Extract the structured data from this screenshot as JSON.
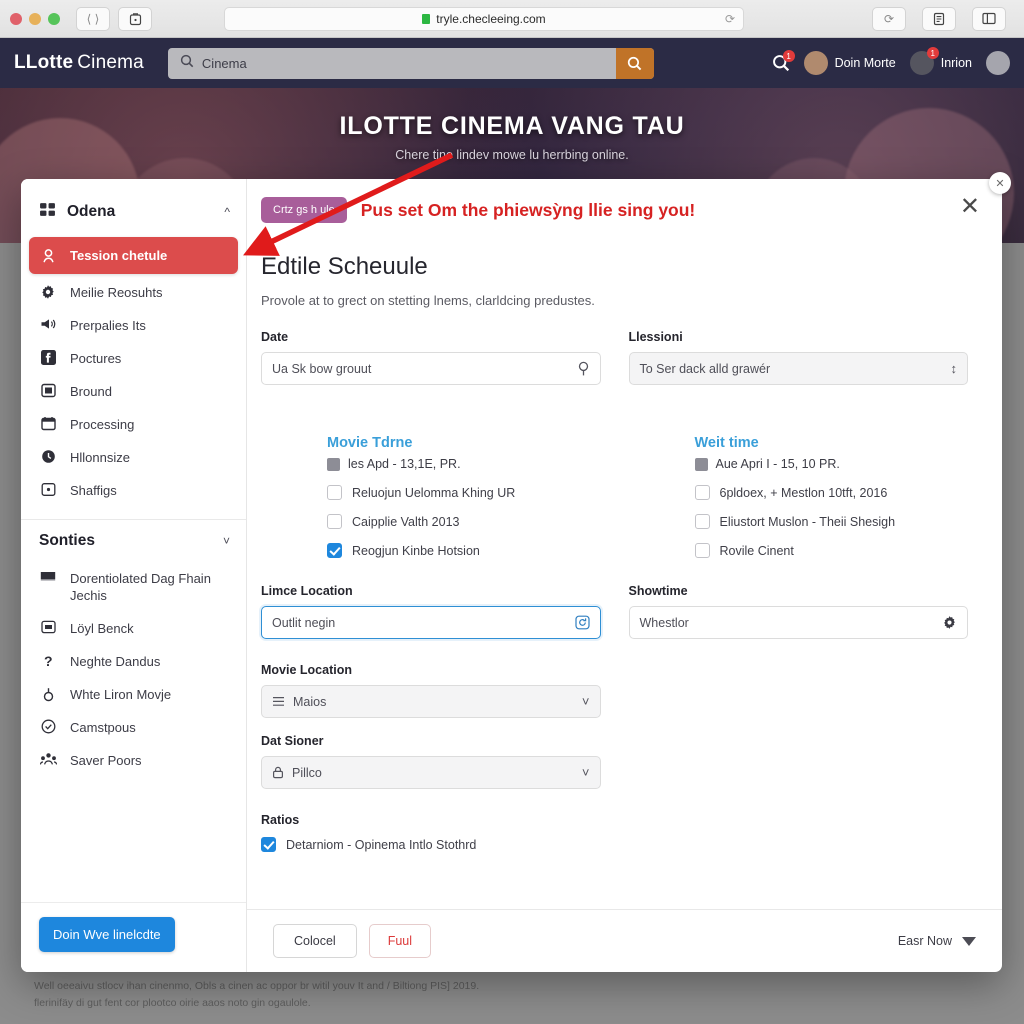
{
  "browser": {
    "url": "tryle.checleeing.com",
    "nav_back_forward_icon": "back-forward-icon",
    "tab_icon": "tab-overview-icon",
    "reload_icon": "reload-icon",
    "share_icon": "share-icon",
    "readinglist_icon": "reading-list-icon",
    "sidebar_icon": "sidebar-icon"
  },
  "site_header": {
    "brand_bold": "LLotte",
    "brand_light": "Cinema",
    "search_value": "Cinema",
    "search_placeholder": "Cinema",
    "search_icon": "search-icon",
    "search_submit_icon": "search-icon",
    "notif_search_badge": "1",
    "user_name": "Doin Morte",
    "menu_name": "Inrion",
    "menu_badge": "1",
    "accent_orange": "#c07328",
    "bar_color": "#2b2b45"
  },
  "hero": {
    "title": "ILOTTE CINEMA VANG TAU",
    "subtitle": "Chere tine lindev mowe lu herrbing online."
  },
  "modal": {
    "close_icon": "close-icon",
    "close_outer_icon": "close-icon",
    "pill_label": "Crtz gs h ule",
    "alert_text": "Pus set Om the phiewsỳng llie sing you!",
    "heading": "Edtile Scheuule",
    "description": "Provole at to grect on stetting lnems, clarldcing predustes.",
    "left": {
      "date_label": "Date",
      "date_value": "Ua Sk bow grouut",
      "date_icon": "location-pin-icon",
      "sub_title": "Movie Tdrne",
      "sub_line": "les Apd - 13,1E, PR.",
      "sub_line_icon": "calendar-icon",
      "options": [
        {
          "label": "Reluojun Uelomma Khing UR",
          "checked": false
        },
        {
          "label": "Caipplie Valth 2013",
          "checked": false
        },
        {
          "label": "Reogjun Kinbe Hotsion",
          "checked": true
        }
      ],
      "lince_label": "Limce Location",
      "lince_value": "Outlit negin",
      "lince_icon": "refresh-circle-icon",
      "movie_loc_label": "Movie Location",
      "movie_loc_value": "Maios",
      "movie_loc_icon": "list-icon",
      "movie_loc_caret": "chevron-down-icon",
      "dat_label": "Dat Sioner",
      "dat_value": "Pillco",
      "dat_icon": "lock-icon",
      "dat_caret": "chevron-down-icon",
      "ratios_label": "Ratios",
      "ratios_option": "Detarniom - Opinema Intlo Stothrd",
      "ratios_checked": true
    },
    "right": {
      "lessioni_label": "Llessioni",
      "lessioni_value": "To Ser dack alld grawér",
      "lessioni_icon": "stepper-icon",
      "sub_title": "Weit time",
      "sub_line": "Aue Apri I - 15, 10 PR.",
      "sub_line_icon": "calendar-icon",
      "options": [
        {
          "label": "6pldoex, + Mestlon 10tft, 2016",
          "checked": false
        },
        {
          "label": "Eliustort Muslon - Theii Shesigh",
          "checked": false
        },
        {
          "label": "Rovile Cinent",
          "checked": false
        }
      ],
      "showtime_label": "Showtime",
      "showtime_value": "Whestlor",
      "showtime_icon": "gear-icon"
    },
    "footer": {
      "cancel_label": "Colocel",
      "submit_label": "Fuul",
      "right_label": "Easr Now",
      "right_caret_icon": "caret-down-icon"
    }
  },
  "sidebar": {
    "group_title": "Odena",
    "group_icon": "building-icon",
    "group_caret_icon": "chevron-up-icon",
    "items": [
      {
        "label": "Tession chetule",
        "icon": "person-pin-icon",
        "active": true
      },
      {
        "label": "Meilie Reosuhts",
        "icon": "gear-icon",
        "active": false
      },
      {
        "label": "Prerpalies Its",
        "icon": "megaphone-icon",
        "active": false
      },
      {
        "label": "Poctures",
        "icon": "facebook-icon",
        "active": false
      },
      {
        "label": "Bround",
        "icon": "image-icon",
        "active": false
      },
      {
        "label": "Processing",
        "icon": "calendar-icon",
        "active": false
      },
      {
        "label": "Hllonnsize",
        "icon": "clock-icon",
        "active": false
      },
      {
        "label": "Shaffigs",
        "icon": "square-icon",
        "active": false
      }
    ],
    "group2_title": "Sonties",
    "group2_caret_icon": "chevron-down-icon",
    "items2": [
      {
        "label": "Dorentiolated Dag Fhain Jechis",
        "icon": "film-icon"
      },
      {
        "label": "Löyl Benck",
        "icon": "window-icon"
      },
      {
        "label": "Neghte Dandus",
        "icon": "question-icon"
      },
      {
        "label": "Whte Liron Movje",
        "icon": "thumb-icon"
      },
      {
        "label": "Camstpous",
        "icon": "check-circle-icon"
      },
      {
        "label": "Saver Poors",
        "icon": "group-icon"
      }
    ],
    "cta_label": "Doin Wve linelcdte",
    "active_color": "#dc4c4c",
    "cta_color": "#1e87dd"
  },
  "page_footer": {
    "line1": "Well oeeaivu stlocv ihan cinenmo, Obls a cinen ac oppor br witil youv It and / Biltiong PIS] 2019.",
    "line2": "flerinifäy di gut fent cor plootco oirie aaos noto gin ogaulole."
  }
}
